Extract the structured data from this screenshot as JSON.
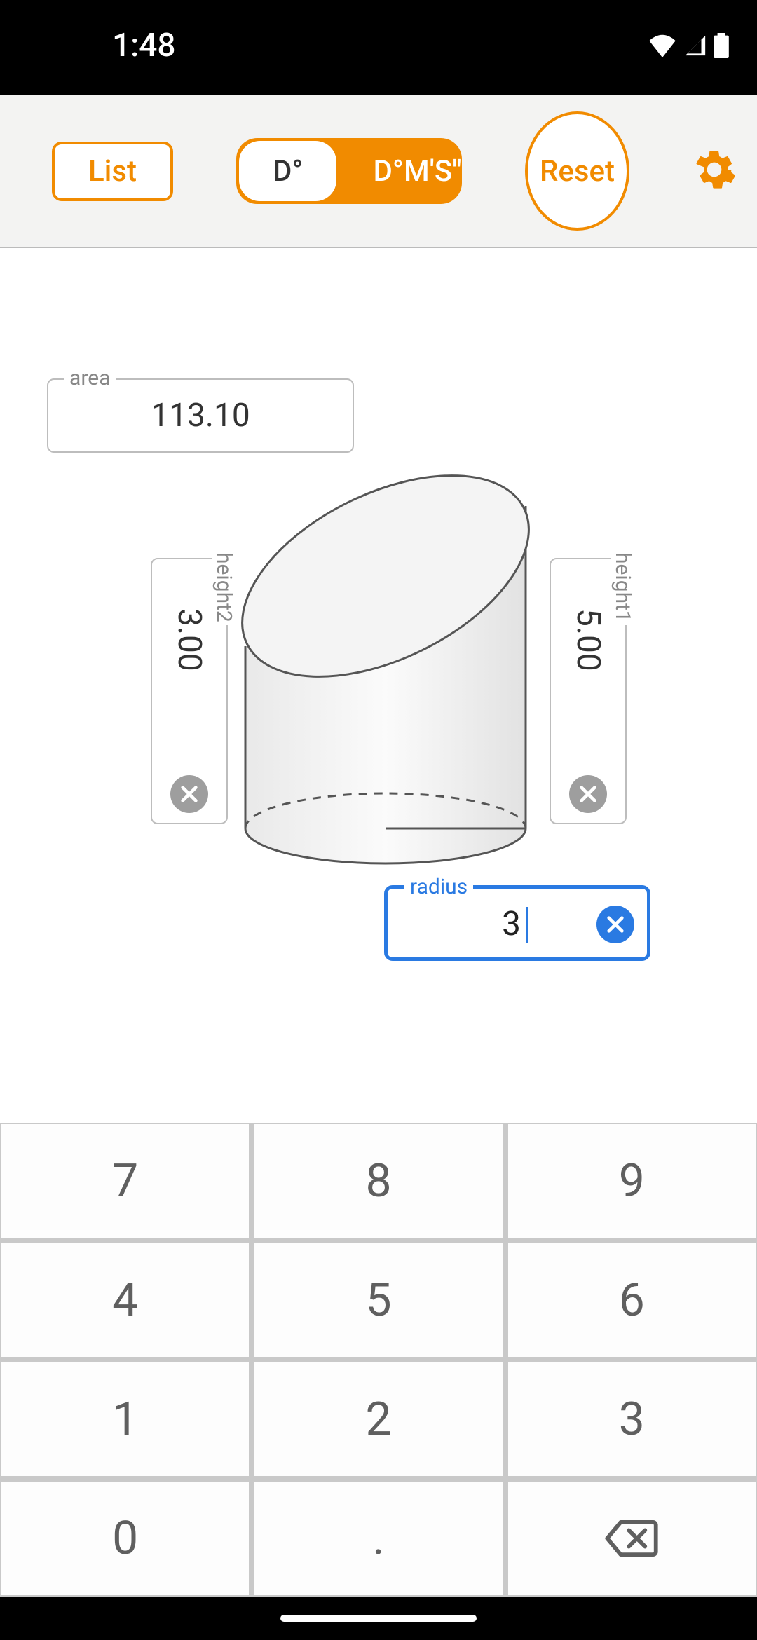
{
  "status": {
    "time": "1:48"
  },
  "toolbar": {
    "list_label": "List",
    "seg_deg_label": "D°",
    "seg_dms_label": "D°M′S″",
    "reset_label": "Reset"
  },
  "fields": {
    "area": {
      "label": "area",
      "value": "113.10"
    },
    "height2": {
      "label": "height2",
      "value": "3.00"
    },
    "height1": {
      "label": "height1",
      "value": "5.00"
    },
    "radius": {
      "label": "radius",
      "value": "3"
    }
  },
  "keypad": {
    "k7": "7",
    "k8": "8",
    "k9": "9",
    "k4": "4",
    "k5": "5",
    "k6": "6",
    "k1": "1",
    "k2": "2",
    "k3": "3",
    "k0": "0",
    "kdot": "."
  },
  "colors": {
    "accent": "#f18b00",
    "active_field": "#2a7ae2"
  }
}
